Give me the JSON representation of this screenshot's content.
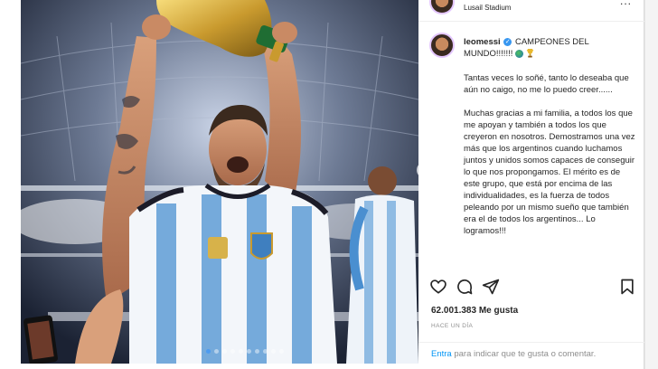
{
  "post": {
    "location": "Lusail Stadium",
    "username": "leomessi",
    "caption_title": "CAMPEONES DEL MUNDO!!!!!!!",
    "caption_body": "Tantas veces lo soñé, tanto lo deseaba que aún no caigo, no me lo puedo creer......\n\nMuchas gracias a mi familia, a todos los que me apoyan y también a todos los que creyeron en nosotros. Demostramos una vez más que los argentinos cuando luchamos juntos y unidos somos capaces de conseguir lo que nos propongamos. El mérito es de este grupo, que está por encima de las individualidades, es la fuerza de todos peleando por un mismo sueño que también era el de todos los argentinos... Lo logramos!!!",
    "likes": "62.001.383 Me gusta",
    "time_ago": "HACE UN DÍA",
    "comment_prefix": "Entra",
    "comment_suffix": " para indicar que te gusta o comentar.",
    "more_label": "...",
    "photo_slides": 10,
    "active_slide": 0
  },
  "icons": {
    "like": "heart-icon",
    "comment": "comment-icon",
    "share": "send-icon",
    "save": "bookmark-icon",
    "next": "chevron-right-icon"
  },
  "colors": {
    "link": "#0095f6",
    "verified": "#3897f0",
    "jersey_blue": "#75aadb"
  }
}
